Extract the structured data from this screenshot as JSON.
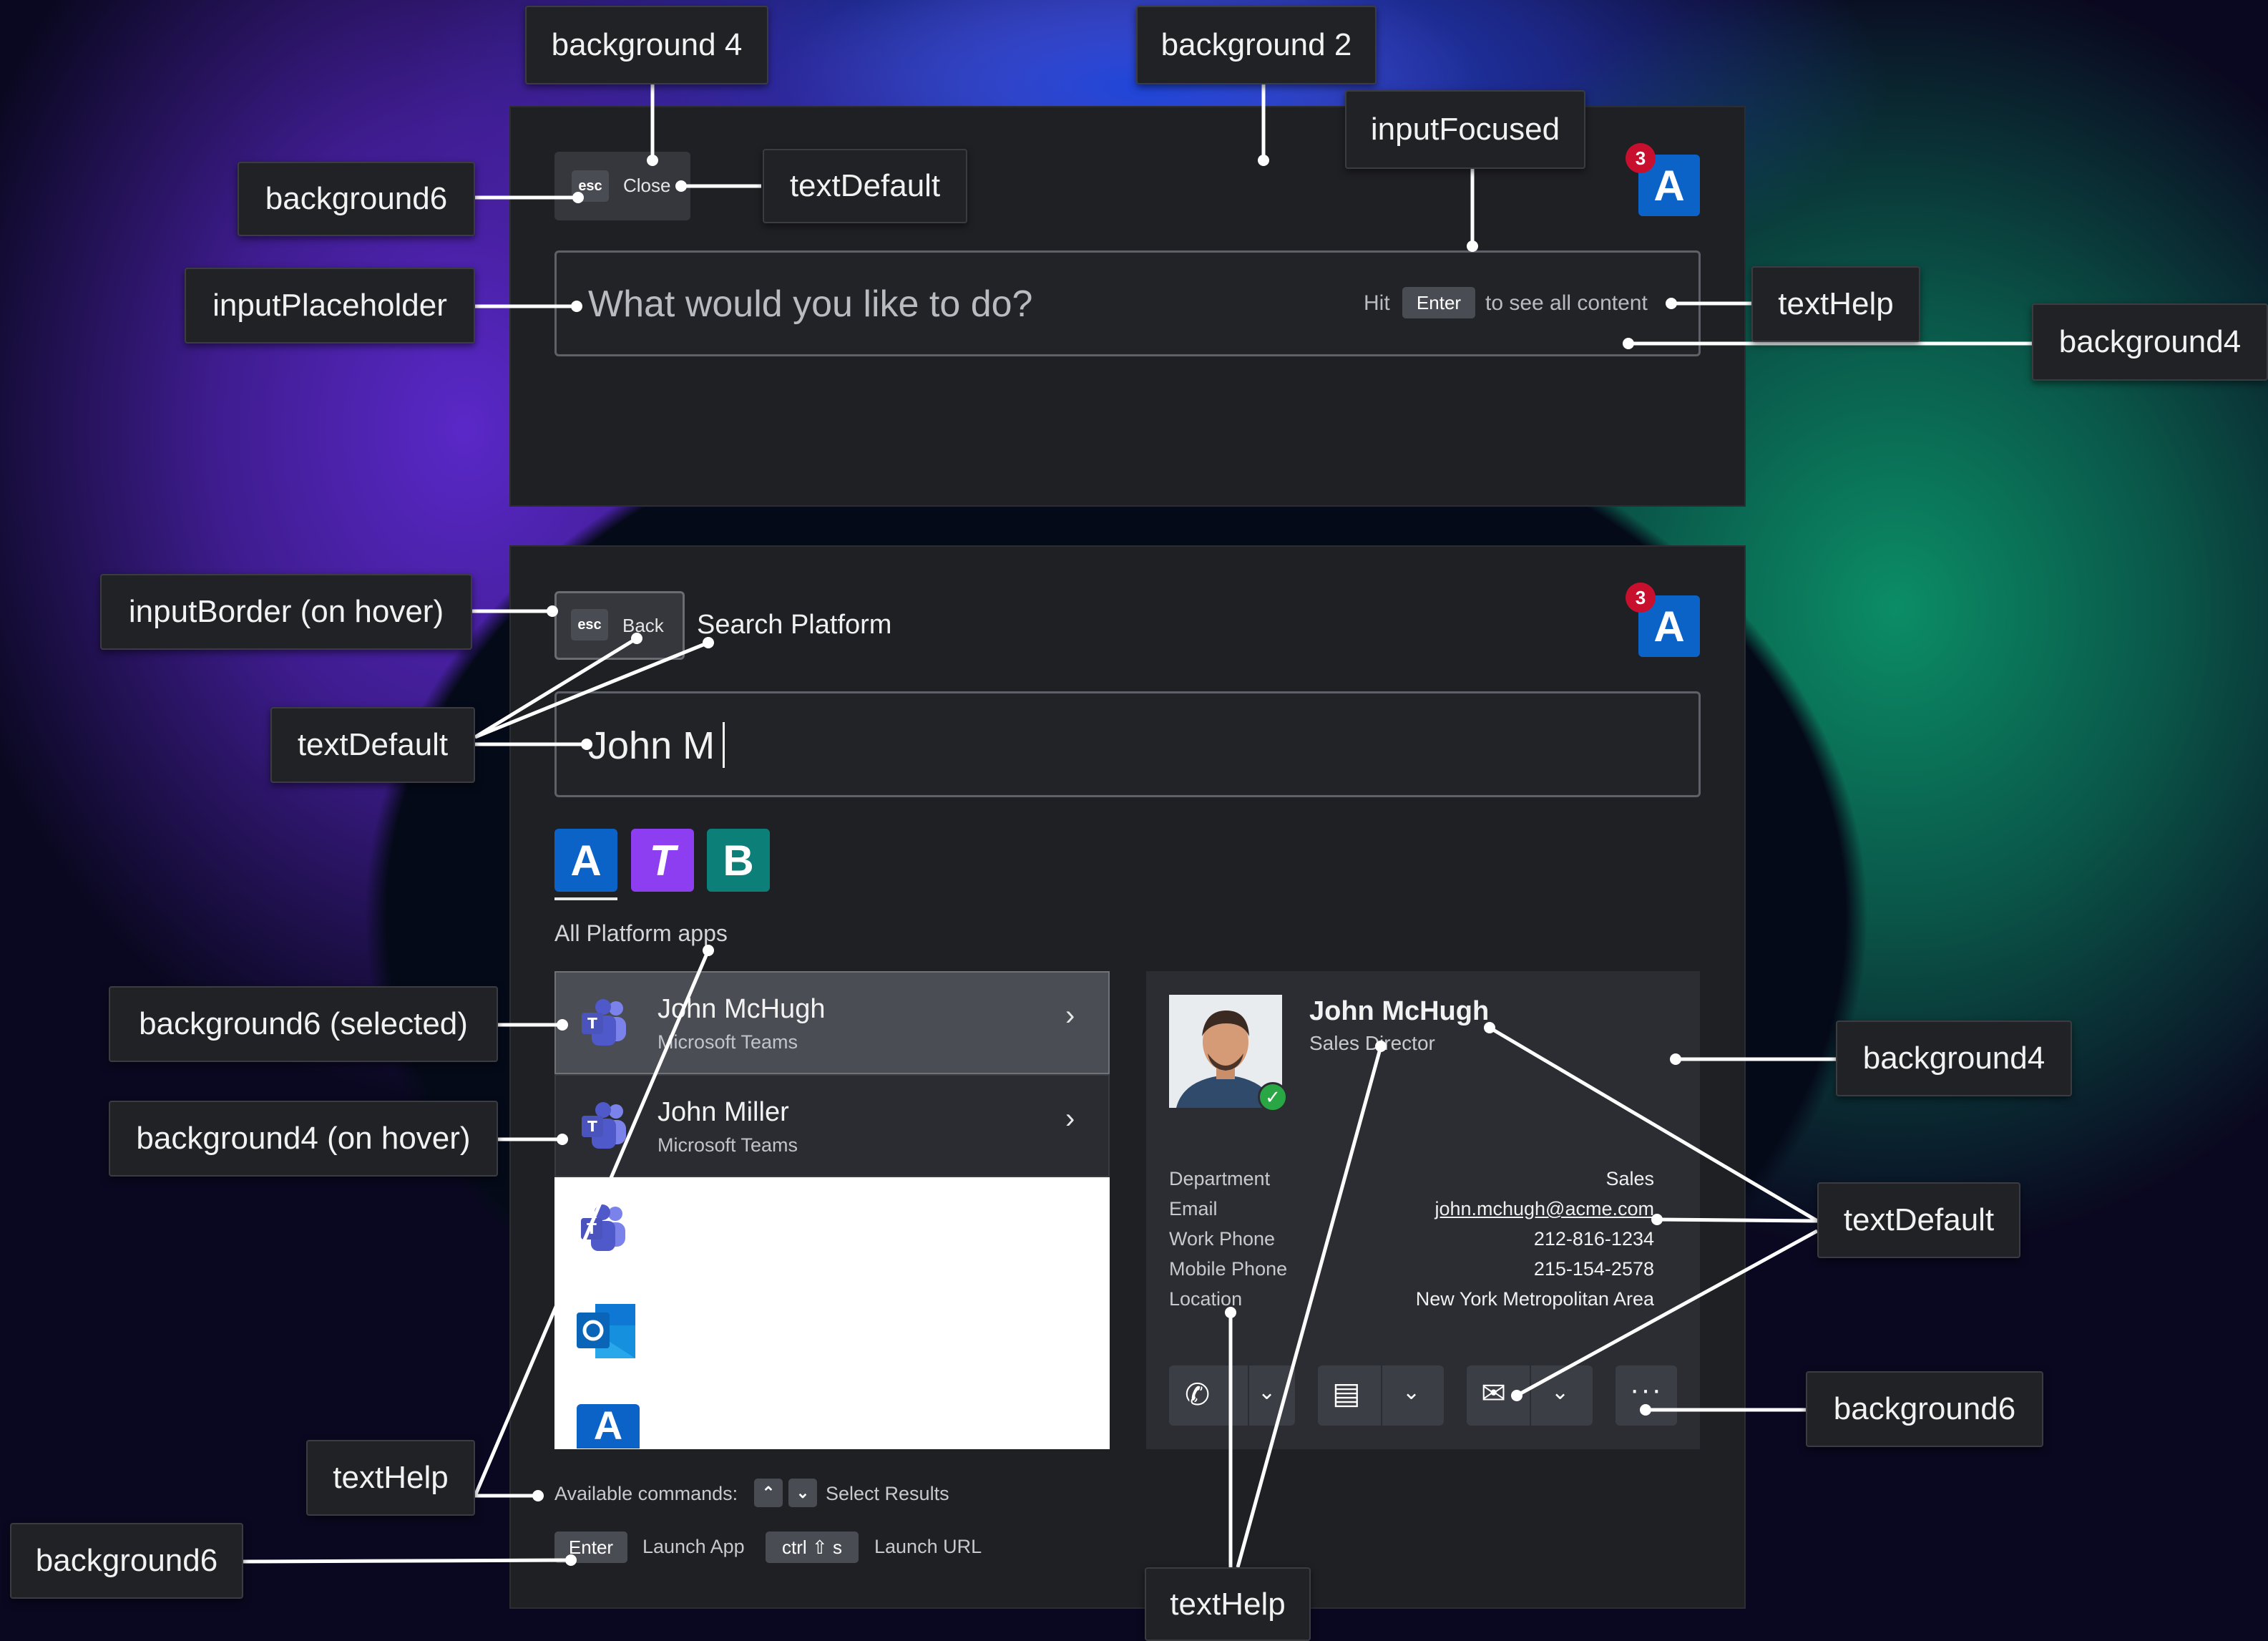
{
  "top_panel": {
    "esc_key": "esc",
    "close_label": "Close",
    "notification_count": "3",
    "input_placeholder": "What would you like to do?",
    "hint_prefix": "Hit",
    "hint_key": "Enter",
    "hint_suffix": "to see all content"
  },
  "bottom_panel": {
    "esc_key": "esc",
    "back_label": "Back",
    "title": "Search Platform",
    "notification_count": "3",
    "search_value": "John M",
    "app_tabs": [
      {
        "letter": "A",
        "color": "#0b63c8"
      },
      {
        "letter": "T",
        "color": "#8d3ef0"
      },
      {
        "letter": "B",
        "color": "#0b7f78"
      }
    ],
    "section_label": "All Platform apps",
    "results": [
      {
        "name": "John McHugh",
        "source": "Microsoft Teams"
      },
      {
        "name": "John Miller",
        "source": "Microsoft Teams"
      }
    ],
    "contact": {
      "name": "John McHugh",
      "title": "Sales Director",
      "details": [
        {
          "label": "Department",
          "value": "Sales"
        },
        {
          "label": "Email",
          "value": "john.mchugh@acme.com"
        },
        {
          "label": "Work Phone",
          "value": "212-816-1234"
        },
        {
          "label": "Mobile Phone",
          "value": "215-154-2578"
        },
        {
          "label": "Location",
          "value": "New York Metropolitan Area"
        }
      ]
    },
    "footer": {
      "available_commands": "Available commands:",
      "select_results": "Select Results",
      "enter_key": "Enter",
      "launch_app": "Launch App",
      "ctrl_key": "ctrl ⇧ s",
      "launch_url": "Launch URL"
    }
  },
  "annotations": {
    "background_4_top": "background 4",
    "background_2": "background 2",
    "input_focused": "inputFocused",
    "background6_top": "background6",
    "text_default_top": "textDefault",
    "input_placeholder": "inputPlaceholder",
    "text_help_top": "textHelp",
    "background4_right_top": "background4",
    "input_border_hover": "inputBorder (on hover)",
    "text_default_left": "textDefault",
    "background6_selected": "background6 (selected)",
    "background4_hover": "background4 (on hover)",
    "background4_right_mid": "background4",
    "text_default_right": "textDefault",
    "background6_right": "background6",
    "text_help_left": "textHelp",
    "background6_bottom": "background6",
    "text_help_bottom": "textHelp"
  }
}
